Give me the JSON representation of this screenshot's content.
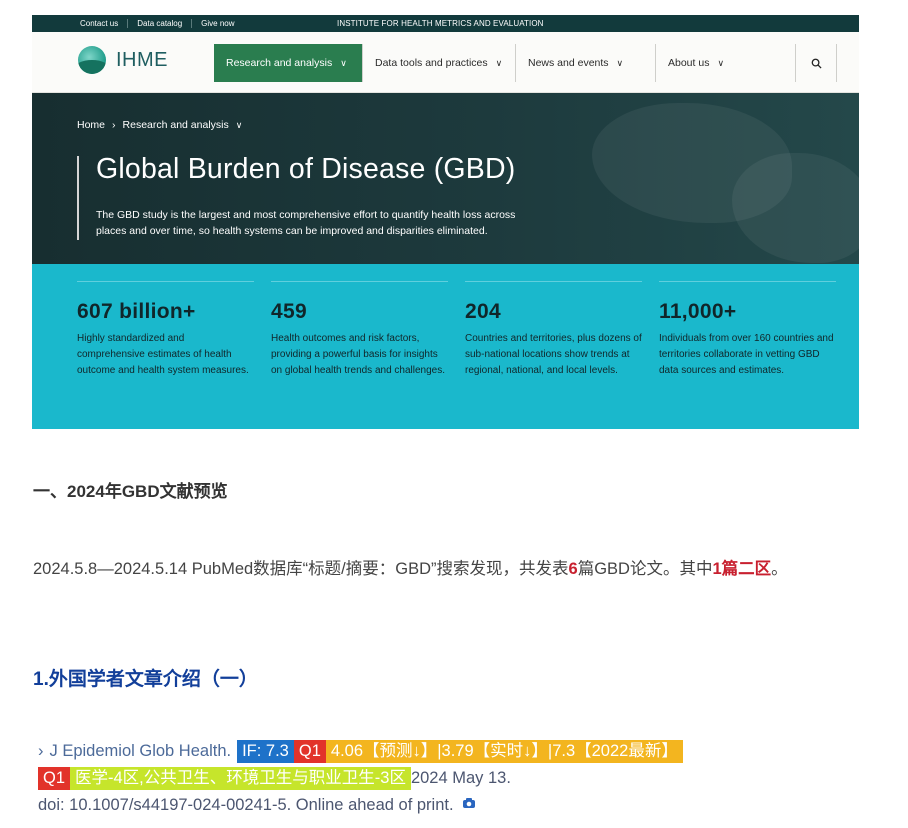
{
  "ihme": {
    "topbar": {
      "links": [
        "Contact us",
        "Data catalog",
        "Give now"
      ],
      "institute": "INSTITUTE FOR HEALTH METRICS AND EVALUATION"
    },
    "logo_text": "IHME",
    "nav": {
      "items": [
        "Research and analysis",
        "Data tools and practices",
        "News and events",
        "About us"
      ],
      "search_icon": "search-icon"
    },
    "breadcrumb": {
      "home": "Home",
      "current": "Research and analysis"
    },
    "hero": {
      "title": "Global Burden of Disease (GBD)",
      "description": "The GBD study is the largest and most comprehensive effort to quantify health loss across places and over time, so health systems can be improved and disparities eliminated."
    },
    "stats": [
      {
        "number": "607 billion+",
        "text": "Highly standardized and comprehensive estimates of health outcome and health system measures."
      },
      {
        "number": "459",
        "text": "Health outcomes and risk factors, providing a powerful basis for insights on global health trends and challenges."
      },
      {
        "number": "204",
        "text": "Countries and territories, plus dozens of sub-national locations show trends at regional, national, and local levels."
      },
      {
        "number": "11,000+",
        "text": "Individuals from over 160 countries and territories collaborate in vetting GBD data sources and estimates."
      }
    ],
    "colors": {
      "topbar": "#123a3c",
      "nav_active": "#2a7d4f",
      "hero": "#1d3a3d",
      "stats": "#1ab8cc"
    }
  },
  "article": {
    "section_title": "一、2024年GBD文献预览",
    "paragraph": {
      "part1": "2024.5.8—2024.5.14 PubMed数据库“标题/摘要：GBD”搜索发现，共发表",
      "count": "6",
      "part2": "篇GBD论文。其中",
      "highlight": "1篇二区",
      "end": "。"
    },
    "subsection_title": "1.外国学者文章介绍（一）",
    "citation": {
      "chevron": "›",
      "journal": "J Epidemiol Glob Health.",
      "if_tag": "IF: 7.3",
      "q_tag": "Q1",
      "forecast_tag": "4.06【预测↓】|3.79【实时↓】|7.3【2022最新】",
      "q_tag2": "Q1",
      "category_tag": "医学-4区,公共卫生、环境卫生与职业卫生-3区",
      "date": "2024 May 13.",
      "doi": "doi: 10.1007/s44197-024-00241-5. Online ahead of print.",
      "camera_icon": "camera-icon"
    },
    "colors": {
      "red": "#c8202f",
      "title_blue": "#123f9a",
      "tag_blue": "#1e72c9",
      "tag_red": "#e2332a",
      "tag_orange": "#f3b51f",
      "tag_lime": "#c6e52b"
    }
  }
}
